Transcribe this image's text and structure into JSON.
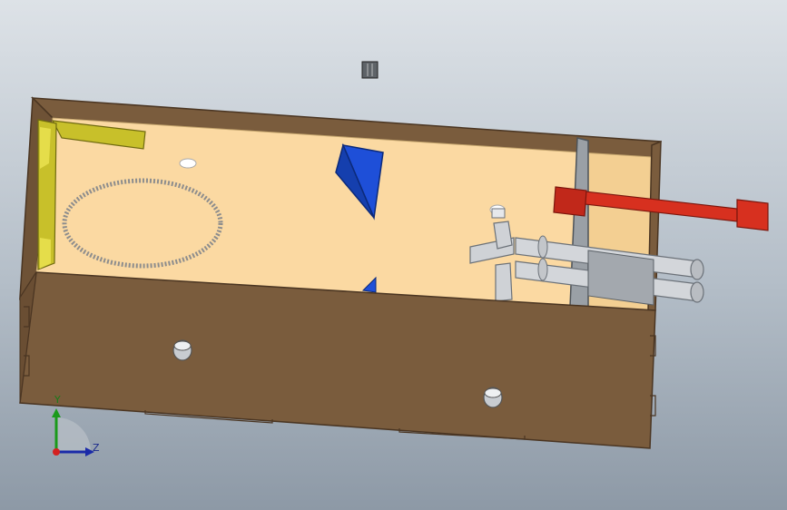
{
  "viewport": {
    "background_top": "#dde2e7",
    "background_bottom": "#8d99a6"
  },
  "model": {
    "colors": {
      "wood": "#7a5c3d",
      "wood_edge": "#4a3522",
      "floor": "#fbd9a2",
      "yellow_bracket": "#c8c02a",
      "blue_wedge": "#1e4fd8",
      "red_rod": "#d7301f",
      "grey_tube": "#c9ccd1",
      "grey_dark": "#7f858c"
    }
  },
  "triad": {
    "y_label": "Y",
    "z_label": "Z",
    "icons": [
      "axis-triad-icon"
    ]
  }
}
